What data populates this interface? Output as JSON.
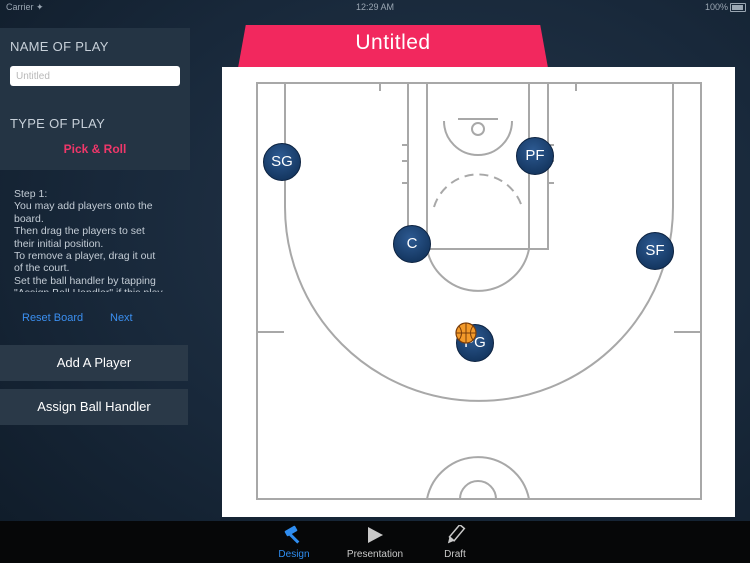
{
  "status_bar": {
    "carrier": "Carrier ✦",
    "time": "12:29 AM",
    "battery": "100%"
  },
  "sidebar": {
    "name_heading": "NAME OF PLAY",
    "name_placeholder": "Untitled",
    "name_value": "",
    "type_heading": "TYPE OF PLAY",
    "type_value": "Pick & Roll",
    "instructions": "Step 1:\nYou may add players onto the board.\nThen drag the players to set their initial position.\nTo remove a player, drag it out of the court.\nSet the ball handler by tapping \"Assign Ball Handler\" if this play",
    "reset_label": "Reset Board",
    "next_label": "Next",
    "add_player_label": "Add A Player",
    "assign_handler_label": "Assign Ball Handler"
  },
  "play": {
    "title": "Untitled"
  },
  "court": {
    "players": [
      {
        "label": "SG"
      },
      {
        "label": "PF"
      },
      {
        "label": "C"
      },
      {
        "label": "SF"
      },
      {
        "label": "PG"
      }
    ],
    "ball_handler": "PG"
  },
  "tabbar": {
    "tabs": [
      {
        "label": "Design",
        "icon": "hammer-icon",
        "active": true
      },
      {
        "label": "Presentation",
        "icon": "play-icon",
        "active": false
      },
      {
        "label": "Draft",
        "icon": "pencil-icon",
        "active": false
      }
    ]
  },
  "colors": {
    "accent": "#f2285e",
    "link": "#3b8ff0",
    "player": "#163964",
    "active_tab": "#2f8df0",
    "inactive_tab": "#c9c9c9",
    "court_lines": "#a8a8a8"
  }
}
